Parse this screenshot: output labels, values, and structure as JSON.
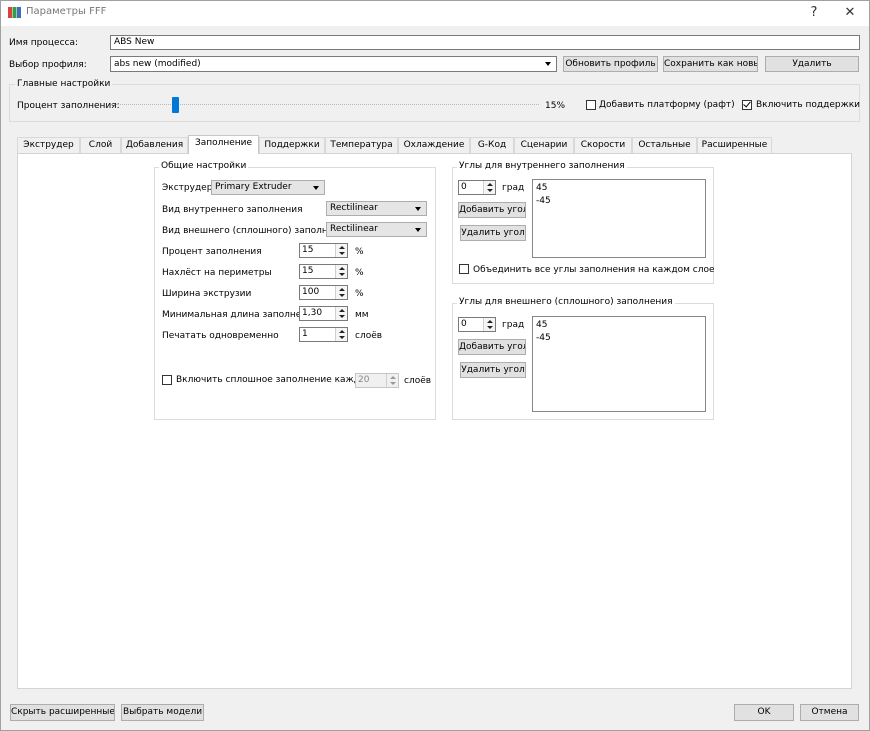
{
  "window": {
    "title": "Параметры FFF",
    "help_glyph": "?",
    "close_glyph": "✕"
  },
  "process": {
    "name_label": "Имя процесса:",
    "name_value": "ABS New",
    "profile_label": "Выбор профиля:",
    "profile_value": "abs new (modified)",
    "update_btn": "Обновить профиль",
    "save_as_btn": "Сохранить как новый",
    "delete_btn": "Удалить"
  },
  "main_settings": {
    "title": "Главные настройки",
    "infill_label": "Процент заполнения:",
    "infill_value": "15%",
    "infill_fraction": 0.15,
    "raft_label": "Добавить платформу (рафт)",
    "raft_checked": false,
    "supports_label": "Включить поддержки",
    "supports_checked": true
  },
  "tabs": [
    "Экструдер",
    "Слой",
    "Добавления",
    "Заполнение",
    "Поддержки",
    "Температура",
    "Охлаждение",
    "G-Код",
    "Сценарии",
    "Скорости",
    "Остальные",
    "Расширенные"
  ],
  "active_tab": "Заполнение",
  "general": {
    "title": "Общие настройки",
    "extruder_label": "Экструдер",
    "extruder_value": "Primary Extruder",
    "interior_label": "Вид внутреннего заполнения",
    "interior_value": "Rectilinear",
    "exterior_label": "Вид внешнего (сплошного) заполнения",
    "exterior_value": "Rectilinear",
    "infill_pct_label": "Процент заполнения",
    "infill_pct_value": "15",
    "infill_pct_unit": "%",
    "overlap_label": "Нахлёст на периметры",
    "overlap_value": "15",
    "overlap_unit": "%",
    "width_label": "Ширина экструзии",
    "width_value": "100",
    "width_unit": "%",
    "minlen_label": "Минимальная длина заполнения",
    "minlen_value": "1,30",
    "minlen_unit": "мм",
    "combine_label": "Печатать одновременно",
    "combine_value": "1",
    "combine_unit": "слоёв",
    "solid_every_label": "Включить сплошное заполнение каждые",
    "solid_every_value": "20",
    "solid_every_unit": "слоёв",
    "solid_every_checked": false
  },
  "interior_angles": {
    "title": "Углы для внутреннего заполнения",
    "spin_value": "0",
    "unit": "град",
    "add_btn": "Добавить угол",
    "remove_btn": "Удалить угол",
    "items": [
      "45",
      "-45"
    ],
    "combine_label": "Объединить все углы заполнения на каждом слое",
    "combine_checked": false
  },
  "exterior_angles": {
    "title": "Углы для внешнего (сплошного) заполнения",
    "spin_value": "0",
    "unit": "град",
    "add_btn": "Добавить угол",
    "remove_btn": "Удалить угол",
    "items": [
      "45",
      "-45"
    ]
  },
  "footer": {
    "hide_advanced": "Скрыть расширенные",
    "select_models": "Выбрать модели",
    "ok": "OK",
    "cancel": "Отмена"
  }
}
